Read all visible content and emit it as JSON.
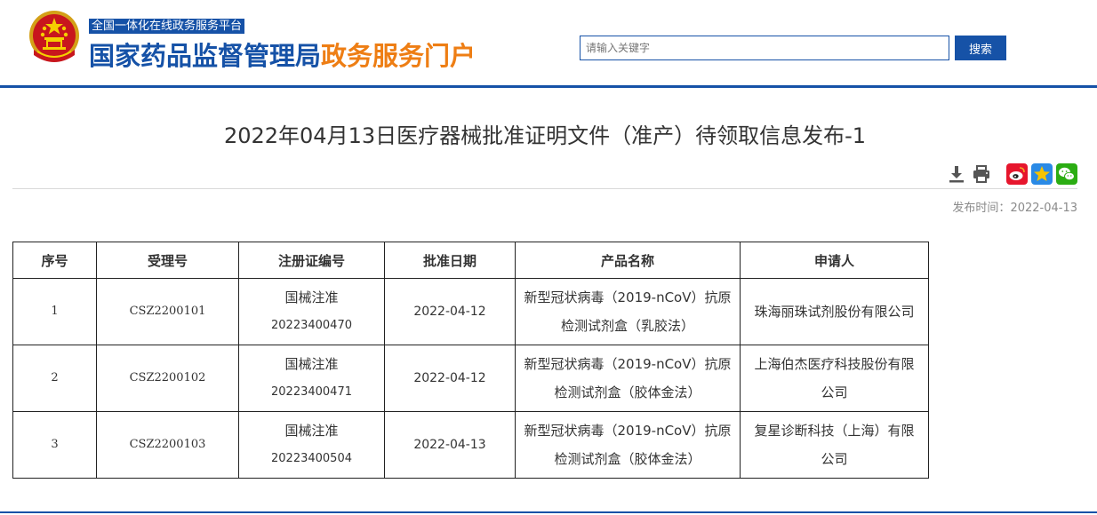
{
  "header": {
    "platform_tag": "全国一体化在线政务服务平台",
    "site_title_main": "国家药品监督管理局",
    "site_title_accent": "政务服务门户",
    "search_placeholder": "请输入关键字",
    "search_button": "搜索"
  },
  "article": {
    "title": "2022年04月13日医疗器械批准证明文件（准产）待领取信息发布-1",
    "publish_label": "发布时间：",
    "publish_date": "2022-04-13"
  },
  "icons": {
    "download": "download-icon",
    "print": "print-icon",
    "weibo": "weibo-icon",
    "qzone": "qzone-icon",
    "wechat": "wechat-icon"
  },
  "colors": {
    "brand_blue": "#1652a7",
    "accent_orange": "#ee7e14",
    "weibo_red": "#e6162d",
    "qzone_blue": "#2a8ae6",
    "wechat_green": "#2bad13"
  },
  "table": {
    "headers": [
      "序号",
      "受理号",
      "注册证编号",
      "批准日期",
      "产品名称",
      "申请人"
    ],
    "rows": [
      {
        "seq": "1",
        "accept_no": "CSZ2200101",
        "reg_no_line1": "国械注准",
        "reg_no_line2": "20223400470",
        "date": "2022-04-12",
        "product_line1": "新型冠状病毒（2019-nCoV）抗原",
        "product_line2": "检测试剂盒（乳胶法）",
        "applicant_line1": "珠海丽珠试剂股份有限公司",
        "applicant_line2": ""
      },
      {
        "seq": "2",
        "accept_no": "CSZ2200102",
        "reg_no_line1": "国械注准",
        "reg_no_line2": "20223400471",
        "date": "2022-04-12",
        "product_line1": "新型冠状病毒（2019-nCoV）抗原",
        "product_line2": "检测试剂盒（胶体金法）",
        "applicant_line1": "上海伯杰医疗科技股份有限",
        "applicant_line2": "公司"
      },
      {
        "seq": "3",
        "accept_no": "CSZ2200103",
        "reg_no_line1": "国械注准",
        "reg_no_line2": "20223400504",
        "date": "2022-04-13",
        "product_line1": "新型冠状病毒（2019-nCoV）抗原",
        "product_line2": "检测试剂盒（胶体金法）",
        "applicant_line1": "复星诊断科技（上海）有限",
        "applicant_line2": "公司"
      }
    ]
  }
}
